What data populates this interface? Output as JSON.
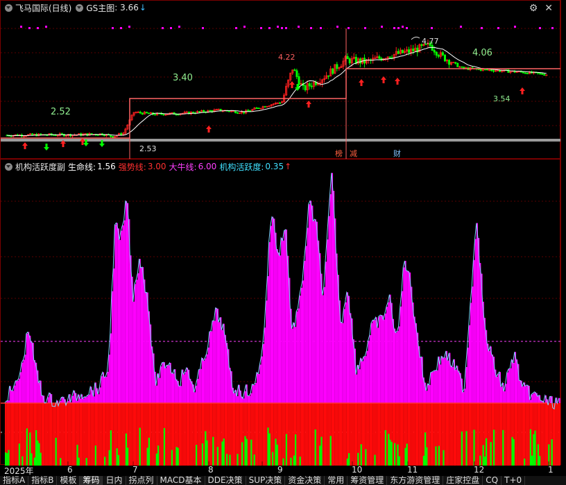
{
  "main_panel": {
    "title": "飞马国际(日线)",
    "indicator_name": "GS主图",
    "indicator_value": ": 3.66",
    "arrow": "↓",
    "price_labels": [
      "4.22",
      "4.77",
      "3.40",
      "4.06",
      "2.52",
      "3.54",
      "2.53"
    ],
    "event_marks": [
      "榜",
      "减",
      "财"
    ]
  },
  "sub_panel": {
    "title": "机构活跃度副",
    "lifeline_label": "生命线:",
    "lifeline_value": "1.56",
    "strong_label": "强势线:",
    "strong_value": "3.00",
    "bull_label": "大牛线:",
    "bull_value": "6.00",
    "activity_label": "机构活跃度:",
    "activity_value": "0.35",
    "arrow": "↑"
  },
  "colors": {
    "border": "#7a0000",
    "up": "#ff2020",
    "down": "#00ff00",
    "magenta": "#ff00ff",
    "level_line": "#ff6464",
    "ma_line": "#ffffff"
  },
  "icons": [
    "gear-icon",
    "close-icon",
    "collapse-icon"
  ],
  "x_axis": {
    "labels": [
      "2025年",
      "6",
      "7",
      "8",
      "9",
      "10",
      "11",
      "12",
      "1"
    ]
  },
  "tabs": [
    "指标A",
    "指标B",
    "模板",
    "筹码",
    "日内",
    "拐点列",
    "MACD基本",
    "DDE决策",
    "SUP决策",
    "资金决策",
    "常用",
    "筹资管理",
    "东方游资管理",
    "庄家控盘",
    "CQ",
    "T+0"
  ]
}
